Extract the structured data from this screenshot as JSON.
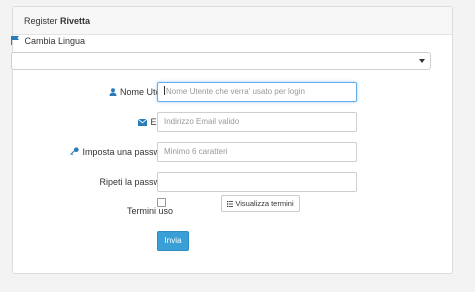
{
  "header": {
    "prefix": "Register",
    "app_name": "Rivetta"
  },
  "language": {
    "label": "Cambia Lingua",
    "selected": ""
  },
  "form": {
    "username": {
      "label": "Nome Utente",
      "placeholder": "Nome Utente che verra' usato per login"
    },
    "email": {
      "label": "Email",
      "placeholder": "Indirizzo Email valido"
    },
    "password": {
      "label": "Imposta una password",
      "placeholder": "Minimo 6 caratteri"
    },
    "repeat_password": {
      "label": "Ripeti la password",
      "placeholder": ""
    },
    "terms": {
      "label": "Termini uso",
      "button_label": "Visualizza termini"
    },
    "submit_label": "Invia"
  },
  "colors": {
    "accent": "#3a9fd6",
    "icon_blue": "#2a7bb8",
    "background": "#f3f3f3"
  }
}
